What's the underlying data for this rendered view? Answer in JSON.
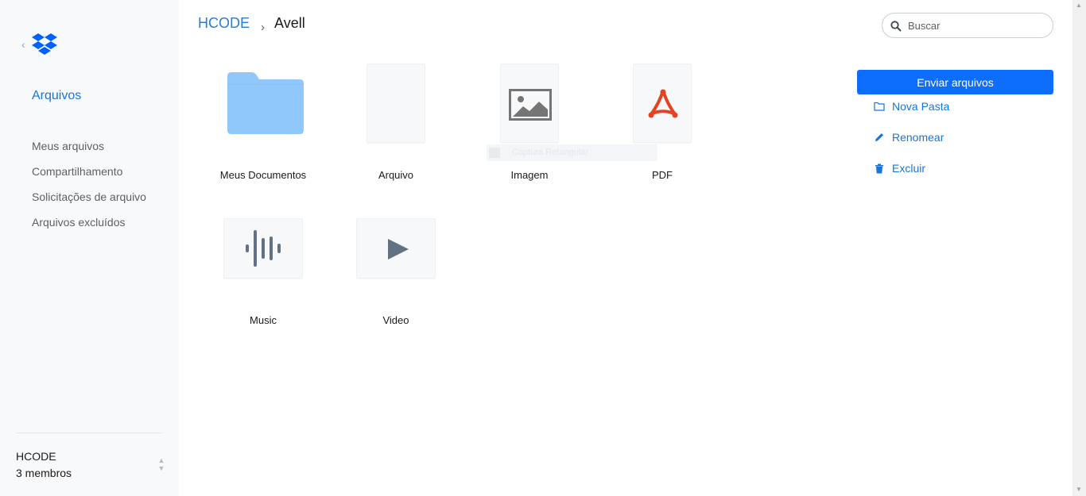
{
  "sidebar": {
    "title": "Arquivos",
    "items": [
      {
        "label": "Meus arquivos"
      },
      {
        "label": "Compartilhamento"
      },
      {
        "label": "Solicitações de arquivo"
      },
      {
        "label": "Arquivos excluídos"
      }
    ],
    "team": {
      "name": "HCODE",
      "members": "3 membros"
    }
  },
  "breadcrumb": {
    "root": "HCODE",
    "separator": "›",
    "current": "Avell"
  },
  "search": {
    "placeholder": "Buscar",
    "value": ""
  },
  "actions": {
    "upload_label": "Enviar arquivos",
    "new_folder_label": "Nova Pasta",
    "rename_label": "Renomear",
    "delete_label": "Excluir"
  },
  "files": [
    {
      "name": "Meus Documentos",
      "type": "folder-icon"
    },
    {
      "name": "Arquivo",
      "type": "file-icon"
    },
    {
      "name": "Imagem",
      "type": "image-icon"
    },
    {
      "name": "PDF",
      "type": "pdf-icon"
    },
    {
      "name": "Music",
      "type": "audio-icon"
    },
    {
      "name": "Video",
      "type": "play-icon"
    }
  ],
  "overlay_ghost": {
    "text": "Captura Retangular"
  },
  "colors": {
    "accent": "#0d6efd",
    "link": "#1a73d6",
    "folder": "#90c8fc",
    "pdf": "#e5431f",
    "icon_gray": "#637282",
    "sidebar_bg": "#f7f9fa"
  }
}
